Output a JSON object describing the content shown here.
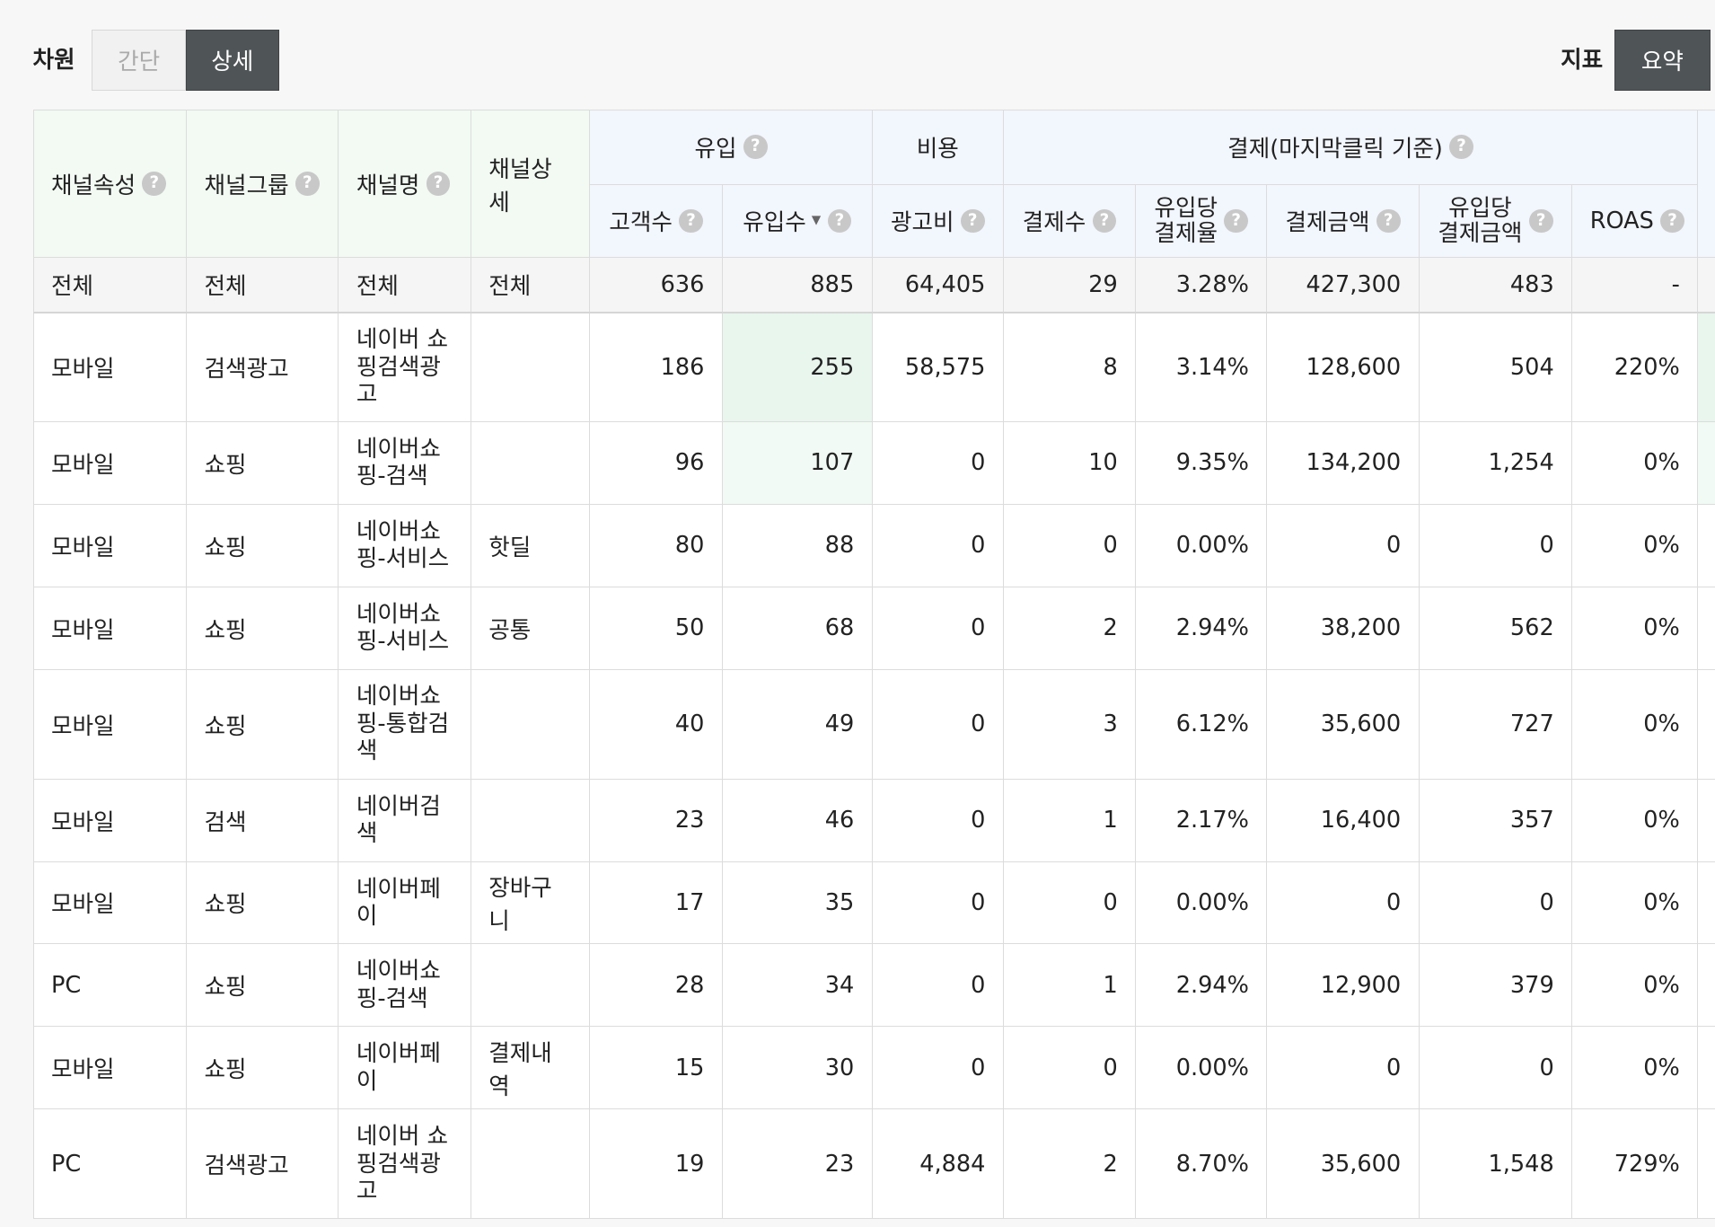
{
  "toolbar": {
    "dimension_label": "차원",
    "simple_label": "간단",
    "detail_label": "상세",
    "metric_label": "지표",
    "summary_label": "요약"
  },
  "table": {
    "headers": {
      "channel_attr": "채널속성",
      "channel_group": "채널그룹",
      "channel_name": "채널명",
      "channel_detail": "채널상세",
      "group_inflow": "유입",
      "group_cost": "비용",
      "group_payment": "결제(마지막클릭 기준)",
      "customers": "고객수",
      "inflows": "유입수",
      "ad_cost": "광고비",
      "payments": "결제수",
      "conv_rate_l1": "유입당",
      "conv_rate_l2": "결제율",
      "pay_amount": "결제금액",
      "amount_per_l1": "유입당",
      "amount_per_l2": "결제금액",
      "roas": "ROAS"
    },
    "help_icon_glyph": "?",
    "total": {
      "attr": "전체",
      "group": "전체",
      "name": "전체",
      "detail": "전체",
      "customers": "636",
      "inflows": "885",
      "ad_cost": "64,405",
      "payments": "29",
      "conv_rate": "3.28%",
      "pay_amount": "427,300",
      "amount_per": "483",
      "roas": "-"
    },
    "rows": [
      {
        "attr": "모바일",
        "group": "검색광고",
        "name": "네이버 쇼\n핑검색광\n고",
        "detail": "",
        "customers": "186",
        "inflows": "255",
        "ad_cost": "58,575",
        "payments": "8",
        "conv_rate": "3.14%",
        "pay_amount": "128,600",
        "amount_per": "504",
        "roas": "220%"
      },
      {
        "attr": "모바일",
        "group": "쇼핑",
        "name": "네이버쇼\n핑-검색",
        "detail": "",
        "customers": "96",
        "inflows": "107",
        "ad_cost": "0",
        "payments": "10",
        "conv_rate": "9.35%",
        "pay_amount": "134,200",
        "amount_per": "1,254",
        "roas": "0%"
      },
      {
        "attr": "모바일",
        "group": "쇼핑",
        "name": "네이버쇼\n핑-서비스",
        "detail": "핫딜",
        "customers": "80",
        "inflows": "88",
        "ad_cost": "0",
        "payments": "0",
        "conv_rate": "0.00%",
        "pay_amount": "0",
        "amount_per": "0",
        "roas": "0%"
      },
      {
        "attr": "모바일",
        "group": "쇼핑",
        "name": "네이버쇼\n핑-서비스",
        "detail": "공통",
        "customers": "50",
        "inflows": "68",
        "ad_cost": "0",
        "payments": "2",
        "conv_rate": "2.94%",
        "pay_amount": "38,200",
        "amount_per": "562",
        "roas": "0%"
      },
      {
        "attr": "모바일",
        "group": "쇼핑",
        "name": "네이버쇼\n핑-통합검\n색",
        "detail": "",
        "customers": "40",
        "inflows": "49",
        "ad_cost": "0",
        "payments": "3",
        "conv_rate": "6.12%",
        "pay_amount": "35,600",
        "amount_per": "727",
        "roas": "0%"
      },
      {
        "attr": "모바일",
        "group": "검색",
        "name": "네이버검\n색",
        "detail": "",
        "customers": "23",
        "inflows": "46",
        "ad_cost": "0",
        "payments": "1",
        "conv_rate": "2.17%",
        "pay_amount": "16,400",
        "amount_per": "357",
        "roas": "0%"
      },
      {
        "attr": "모바일",
        "group": "쇼핑",
        "name": "네이버페\n이",
        "detail": "장바구니",
        "customers": "17",
        "inflows": "35",
        "ad_cost": "0",
        "payments": "0",
        "conv_rate": "0.00%",
        "pay_amount": "0",
        "amount_per": "0",
        "roas": "0%"
      },
      {
        "attr": "PC",
        "group": "쇼핑",
        "name": "네이버쇼\n핑-검색",
        "detail": "",
        "customers": "28",
        "inflows": "34",
        "ad_cost": "0",
        "payments": "1",
        "conv_rate": "2.94%",
        "pay_amount": "12,900",
        "amount_per": "379",
        "roas": "0%"
      },
      {
        "attr": "모바일",
        "group": "쇼핑",
        "name": "네이버페\n이",
        "detail": "결제내역",
        "customers": "15",
        "inflows": "30",
        "ad_cost": "0",
        "payments": "0",
        "conv_rate": "0.00%",
        "pay_amount": "0",
        "amount_per": "0",
        "roas": "0%"
      },
      {
        "attr": "PC",
        "group": "검색광고",
        "name": "네이버 쇼\n핑검색광\n고",
        "detail": "",
        "customers": "19",
        "inflows": "23",
        "ad_cost": "4,884",
        "payments": "2",
        "conv_rate": "8.70%",
        "pay_amount": "35,600",
        "amount_per": "1,548",
        "roas": "729%"
      }
    ]
  }
}
